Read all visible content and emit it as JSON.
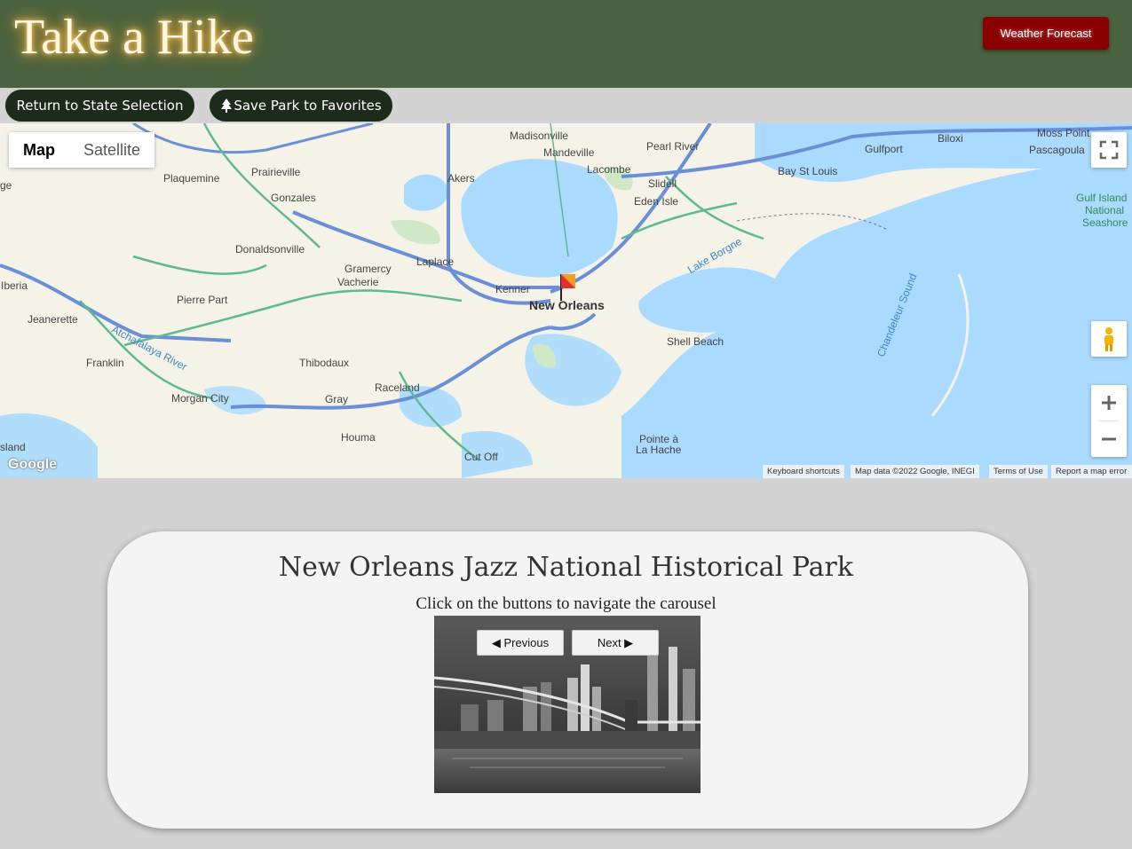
{
  "header": {
    "title": "Take a Hike",
    "weather_button": "Weather Forecast"
  },
  "actions": {
    "return_label": "Return to State Selection",
    "save_label": "Save Park to Favorites"
  },
  "map": {
    "type_map": "Map",
    "type_satellite": "Satellite",
    "logo": "Google",
    "attribution": {
      "shortcuts": "Keyboard shortcuts",
      "data": "Map data ©2022 Google, INEGI",
      "terms": "Terms of Use",
      "report": "Report a map error"
    },
    "labels": {
      "new_orleans": "New Orleans",
      "kenner": "Kenner",
      "laplace": "Laplace",
      "madisonville": "Madisonville",
      "mandeville": "Mandeville",
      "pearl_river": "Pearl River",
      "lacombe": "Lacombe",
      "slidell": "Slidell",
      "eden_isle": "Eden Isle",
      "akers": "Akers",
      "prairieville": "Prairieville",
      "plaquemine": "Plaquemine",
      "gonzales": "Gonzales",
      "donaldsonville": "Donaldsonville",
      "gramercy": "Gramercy",
      "vacherie": "Vacherie",
      "pierre_part": "Pierre Part",
      "jeanerette": "Jeanerette",
      "iberia": "Iberia",
      "franklin": "Franklin",
      "thibodaux": "Thibodaux",
      "raceland": "Raceland",
      "morgan_city": "Morgan City",
      "gray": "Gray",
      "houma": "Houma",
      "cut_off": "Cut Off",
      "shell_beach": "Shell Beach",
      "pointe_a_la_hache_1": "Pointe à",
      "pointe_a_la_hache_2": "La Hache",
      "gulfport": "Gulfport",
      "biloxi": "Biloxi",
      "bay_st_louis": "Bay St Louis",
      "moss_point": "Moss Point",
      "pascagoula": "Pascagoula",
      "lake_borgne": "Lake Borgne",
      "chandeleur": "Chandeleur Sound",
      "atchafalaya": "Atchafalaya River",
      "gulf_islands_1": "Gulf Island",
      "gulf_islands_2": "National",
      "gulf_islands_3": "Seashore",
      "island": "sland",
      "ge": "ge"
    }
  },
  "park": {
    "name": "New Orleans Jazz National Historical Park",
    "instructions": "Click on the buttons to navigate the carousel",
    "prev_label": "◀ Previous",
    "next_label": "Next ▶"
  },
  "colors": {
    "header_bg": "#4a6340",
    "weather_btn": "#8b0000",
    "pill_bg": "#1d2b1b",
    "water": "#aadaff",
    "land": "#f5f3e8"
  }
}
